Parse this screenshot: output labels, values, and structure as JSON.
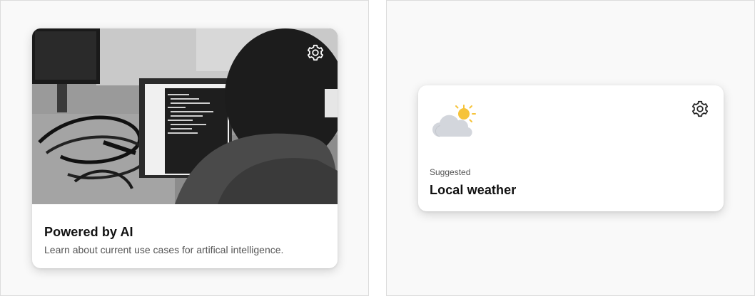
{
  "cards": {
    "ai": {
      "title": "Powered by AI",
      "description": "Learn about current use cases for artifical intelligence.",
      "settings_icon": "gear-icon",
      "image": "person-coding-at-laptop-photo"
    },
    "weather": {
      "eyebrow": "Suggested",
      "title": "Local weather",
      "settings_icon": "gear-icon",
      "weather_icon": "partly-cloudy-icon"
    }
  },
  "colors": {
    "sun": "#f6c33a",
    "cloud": "#d3d6dc",
    "title": "#111111",
    "muted": "#555555"
  }
}
